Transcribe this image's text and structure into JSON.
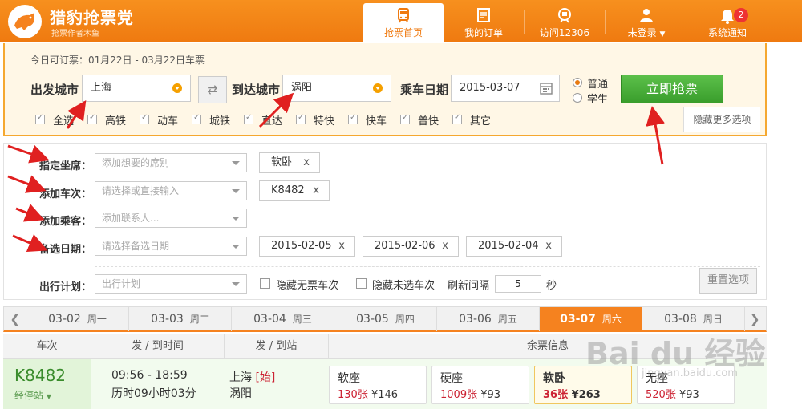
{
  "header": {
    "logo_name": "猎豹抢票党",
    "logo_sub": "抢票作者木鱼",
    "nav": [
      {
        "label": "抢票首页",
        "icon": "bus-icon",
        "active": true
      },
      {
        "label": "我的订单",
        "icon": "order-icon",
        "active": false
      },
      {
        "label": "访问12306",
        "icon": "train-icon",
        "active": false
      },
      {
        "label": "未登录",
        "icon": "user-icon",
        "active": false
      },
      {
        "label": "系统通知",
        "icon": "bell-icon",
        "active": false,
        "badge": "2"
      }
    ]
  },
  "search": {
    "presale_info": "今日可订票：01月22日 - 03月22日车票",
    "from_label": "出发城市",
    "from_value": "上海",
    "to_label": "到达城市",
    "to_value": "涡阳",
    "date_label": "乘车日期",
    "date_value": "2015-03-07",
    "ticket_types": [
      {
        "label": "普通",
        "checked": true
      },
      {
        "label": "学生",
        "checked": false
      }
    ],
    "grab_button": "立即抢票",
    "train_types": [
      "全选",
      "高铁",
      "动车",
      "城铁",
      "直达",
      "特快",
      "快车",
      "普快",
      "其它"
    ],
    "more_options": "隐藏更多选项"
  },
  "options": {
    "seat_label": "指定坐席：",
    "seat_placeholder": "添加想要的席别",
    "seat_tags": [
      "软卧"
    ],
    "train_label": "添加车次：",
    "train_placeholder": "请选择或直接输入",
    "train_tags": [
      "K8482"
    ],
    "passenger_label": "添加乘客：",
    "passenger_placeholder": "添加联系人...",
    "alt_date_label": "备选日期：",
    "alt_date_placeholder": "请选择备选日期",
    "alt_date_tags": [
      "2015-02-05",
      "2015-02-06",
      "2015-02-04"
    ],
    "plan_label": "出行计划：",
    "plan_placeholder": "出行计划",
    "hide_no_ticket": "隐藏无票车次",
    "hide_unselected": "隐藏未选车次",
    "refresh_label": "刷新间隔",
    "refresh_value": "5",
    "refresh_unit": "秒",
    "reset_button": "重置选项",
    "tag_close": "x"
  },
  "datebar": {
    "dates": [
      {
        "date": "03-02",
        "weekday": "周一",
        "active": false
      },
      {
        "date": "03-03",
        "weekday": "周二",
        "active": false
      },
      {
        "date": "03-04",
        "weekday": "周三",
        "active": false
      },
      {
        "date": "03-05",
        "weekday": "周四",
        "active": false
      },
      {
        "date": "03-06",
        "weekday": "周五",
        "active": false
      },
      {
        "date": "03-07",
        "weekday": "周六",
        "active": true
      },
      {
        "date": "03-08",
        "weekday": "周日",
        "active": false
      }
    ],
    "prev": "❮",
    "next": "❯"
  },
  "table": {
    "headers": [
      "车次",
      "发 / 到时间",
      "发 / 到站",
      "余票信息"
    ],
    "row": {
      "train_no": "K8482",
      "stopover": "经停站",
      "times": "09:56 - 18:59",
      "duration": "历时09小时03分",
      "from_station": "上海",
      "from_tag": "[始]",
      "to_station": "涡阳",
      "seats": [
        {
          "name": "软座",
          "count": "130张",
          "price": "¥146",
          "selected": false
        },
        {
          "name": "硬座",
          "count": "1009张",
          "price": "¥93",
          "selected": false
        },
        {
          "name": "软卧",
          "count": "36张",
          "price": "¥263",
          "selected": true
        },
        {
          "name": "无座",
          "count": "520张",
          "price": "¥93",
          "selected": false
        }
      ]
    }
  },
  "watermark": {
    "main": "Bai du 经验",
    "sub": "jingyan.baidu.com"
  },
  "colors": {
    "brand": "#f5821f",
    "grab": "#3a9e2c",
    "arrow": "#e02020"
  }
}
